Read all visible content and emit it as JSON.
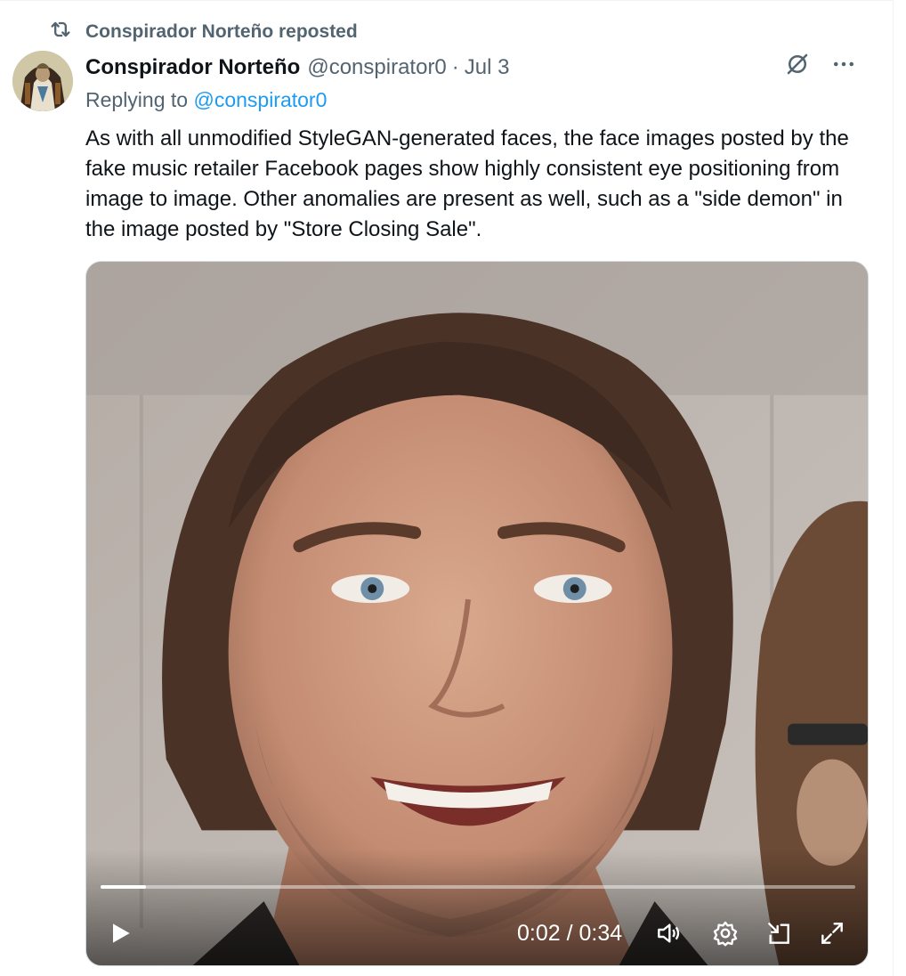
{
  "repost": {
    "icon": "repost-icon",
    "label": "Conspirador Norteño reposted"
  },
  "tweet": {
    "author_name": "Conspirador Norteño",
    "author_handle": "@conspirator0",
    "separator": "·",
    "date": "Jul 3",
    "reply_prefix": "Replying to",
    "reply_mention": "@conspirator0",
    "text": "As with all unmodified StyleGAN-generated faces, the face images posted by the fake music retailer Facebook pages show highly consistent eye positioning from image to image. Other anomalies are present as well, such as a \"side demon\" in the image posted by \"Store Closing Sale\".",
    "actions": [
      "grok-icon",
      "more-icon"
    ]
  },
  "video": {
    "time": "0:02 / 0:34",
    "progress_fraction": 0.06,
    "controls": [
      "play-icon",
      "volume-icon",
      "settings-icon",
      "pip-icon",
      "fullscreen-icon"
    ]
  },
  "colors": {
    "accent": "#1d9bf0",
    "secondary_text": "#536471",
    "primary_text": "#0f1419"
  }
}
